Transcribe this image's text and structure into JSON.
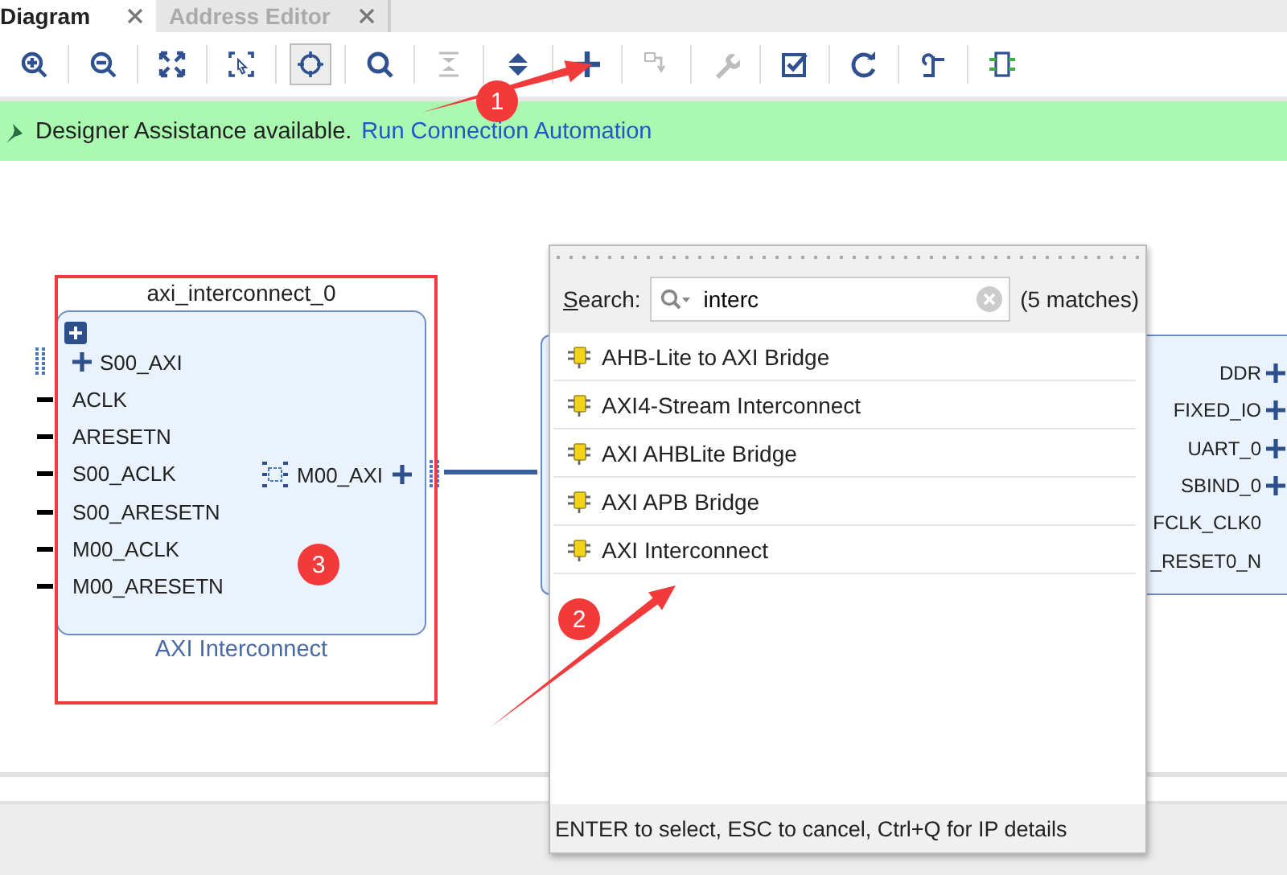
{
  "tabs": [
    {
      "label": "Diagram",
      "selected": true
    },
    {
      "label": "Address Editor",
      "selected": false
    }
  ],
  "toolbar": [
    {
      "kind": "zoom-in",
      "selected": false,
      "disabled": false
    },
    {
      "kind": "zoom-out",
      "selected": false,
      "disabled": false
    },
    {
      "kind": "fit",
      "selected": false,
      "disabled": false
    },
    {
      "kind": "zoom-area",
      "selected": false,
      "disabled": false
    },
    {
      "kind": "crosshair",
      "selected": true,
      "disabled": false
    },
    {
      "kind": "search",
      "selected": false,
      "disabled": false
    },
    {
      "kind": "collapse",
      "selected": false,
      "disabled": true
    },
    {
      "kind": "expand",
      "selected": false,
      "disabled": false
    },
    {
      "kind": "add",
      "selected": false,
      "disabled": false
    },
    {
      "kind": "route",
      "selected": false,
      "disabled": true
    },
    {
      "kind": "wrench",
      "selected": false,
      "disabled": true
    },
    {
      "kind": "validate",
      "selected": false,
      "disabled": false
    },
    {
      "kind": "refresh",
      "selected": false,
      "disabled": false
    },
    {
      "kind": "regenerate",
      "selected": false,
      "disabled": false
    },
    {
      "kind": "chip",
      "selected": false,
      "disabled": false
    }
  ],
  "banner": {
    "text": "Designer Assistance available.",
    "link": "Run Connection Automation"
  },
  "block": {
    "instance": "axi_interconnect_0",
    "caption": "AXI Interconnect",
    "inputs": [
      {
        "label": "S00_AXI",
        "kind": "bus"
      },
      {
        "label": "ACLK",
        "kind": "pin"
      },
      {
        "label": "ARESETN",
        "kind": "pin"
      },
      {
        "label": "S00_ACLK",
        "kind": "pin"
      },
      {
        "label": "S00_ARESETN",
        "kind": "pin"
      },
      {
        "label": "M00_ACLK",
        "kind": "pin"
      },
      {
        "label": "M00_ARESETN",
        "kind": "pin"
      }
    ],
    "outputs": [
      {
        "label": "M00_AXI",
        "kind": "bus"
      }
    ]
  },
  "right_block": {
    "ports": [
      {
        "label": "DDR",
        "kind": "bus"
      },
      {
        "label": "FIXED_IO",
        "kind": "bus"
      },
      {
        "label": "UART_0",
        "kind": "bus"
      },
      {
        "label": "SBIND_0",
        "kind": "bus"
      },
      {
        "label": "FCLK_CLK0",
        "kind": "pin"
      },
      {
        "label": "_RESET0_N",
        "kind": "pin"
      }
    ]
  },
  "popup": {
    "search_label": "Search:",
    "query": "interc",
    "matches": "(5 matches)",
    "results": [
      {
        "label": "AHB-Lite to AXI Bridge",
        "selected": false
      },
      {
        "label": "AXI4-Stream Interconnect",
        "selected": false
      },
      {
        "label": "AXI AHBLite Bridge",
        "selected": false
      },
      {
        "label": "AXI APB Bridge",
        "selected": false
      },
      {
        "label": "AXI Interconnect",
        "selected": false
      }
    ],
    "hint": "ENTER to select, ESC to cancel, Ctrl+Q for IP details"
  },
  "annotations": [
    {
      "number": "1"
    },
    {
      "number": "2"
    },
    {
      "number": "3"
    }
  ]
}
